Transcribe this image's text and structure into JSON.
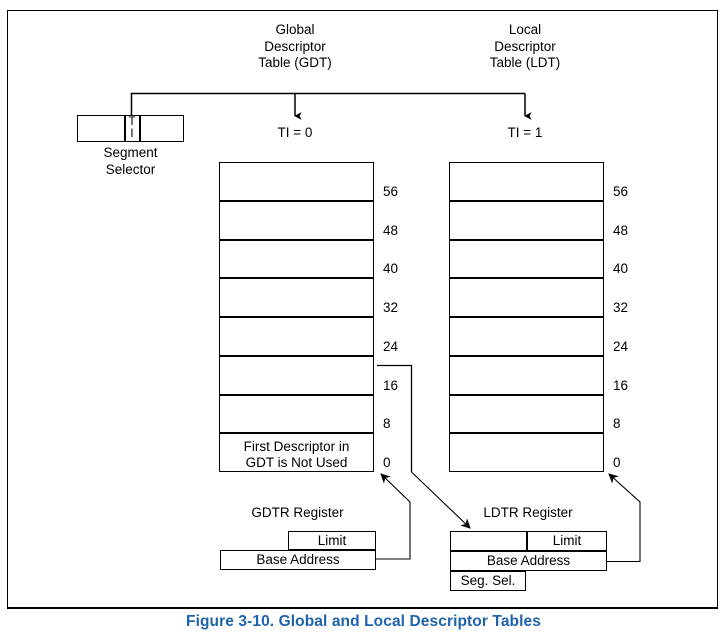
{
  "figure": {
    "caption": "Figure 3-10.  Global and Local Descriptor Tables",
    "caption_color": "#1f63ad",
    "line_color": "#000000",
    "background": "#ffffff"
  },
  "segment_selector": {
    "label_line1": "Segment",
    "label_line2": "Selector",
    "ti_field_line1": "TI",
    "ti_field_line2": "I",
    "ti_field_text": "TI"
  },
  "gdt": {
    "heading_line1": "Global",
    "heading_line2": "Descriptor",
    "heading_line3": "Table (GDT)",
    "ti_value_label": "TI = 0",
    "offsets": [
      "56",
      "48",
      "40",
      "32",
      "24",
      "16",
      "8",
      "0"
    ],
    "rows": [
      "",
      "",
      "",
      "",
      "",
      "",
      "",
      "First Descriptor in\nGDT is Not Used"
    ],
    "first_entry_line1": "First Descriptor in",
    "first_entry_line2": "GDT is Not Used"
  },
  "ldt": {
    "heading_line1": "Local",
    "heading_line2": "Descriptor",
    "heading_line3": "Table (LDT)",
    "ti_value_label": "TI = 1",
    "offsets": [
      "56",
      "48",
      "40",
      "32",
      "24",
      "16",
      "8",
      "0"
    ],
    "rows": [
      "",
      "",
      "",
      "",
      "",
      "",
      "",
      ""
    ]
  },
  "gdtr": {
    "title": "GDTR Register",
    "limit_label": "Limit",
    "base_address_label": "Base Address"
  },
  "ldtr": {
    "title": "LDTR Register",
    "limit_label": "Limit",
    "base_address_label": "Base Address",
    "seg_sel_label": "Seg. Sel."
  }
}
